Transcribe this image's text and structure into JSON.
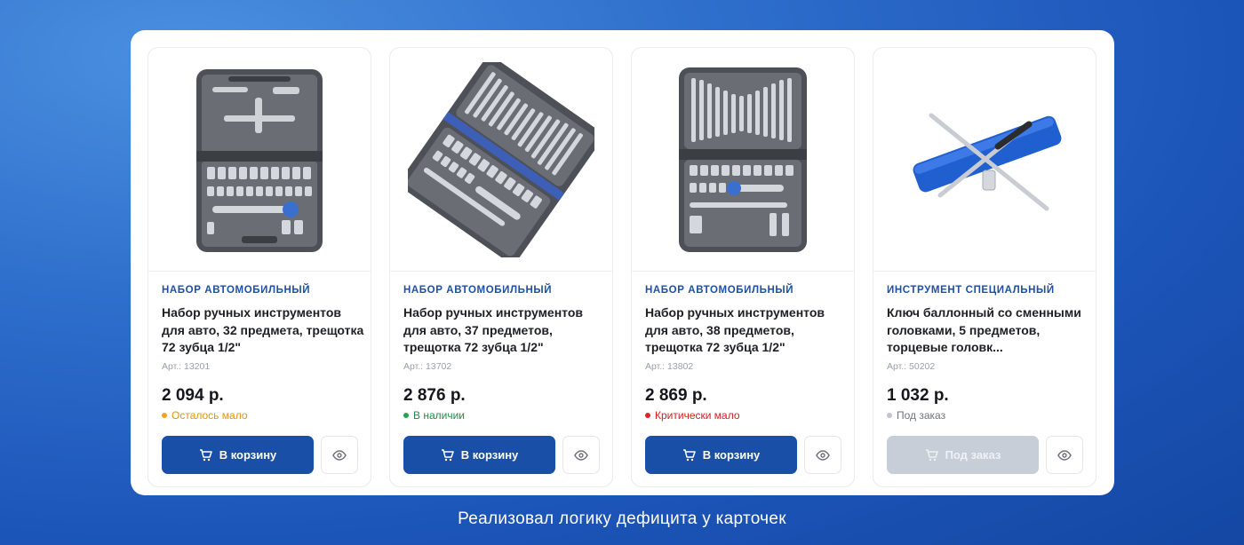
{
  "caption": "Реализовал логику дефицита у карточек",
  "products": [
    {
      "image": "tool-case-socket-set-icon",
      "category": "НАБОР АВТОМОБИЛЬНЫЙ",
      "title": "Набор ручных инструментов для авто, 32 предмета, трещотка 72 зубца 1/2\"",
      "article": "Арт.: 13201",
      "price": "2 094 р.",
      "stock": "Осталось мало",
      "stock_color": "#f0a21a",
      "stock_text_color": "#e09312",
      "button": "В корзину",
      "button_disabled": false
    },
    {
      "image": "tool-case-wrench-set-icon",
      "category": "НАБОР АВТОМОБИЛЬНЫЙ",
      "title": "Набор ручных инструментов для авто, 37 предметов, трещотка 72 зубца 1/2\"",
      "article": "Арт.: 13702",
      "price": "2 876 р.",
      "stock": "В наличии",
      "stock_color": "#26a353",
      "stock_text_color": "#1f8d47",
      "button": "В корзину",
      "button_disabled": false
    },
    {
      "image": "tool-case-wrench-set-icon",
      "category": "НАБОР АВТОМОБИЛЬНЫЙ",
      "title": "Набор ручных инструментов для авто, 38 предметов, трещотка 72 зубца 1/2\"",
      "article": "Арт.: 13802",
      "price": "2 869 р.",
      "stock": "Критически мало",
      "stock_color": "#e02424",
      "stock_text_color": "#d11f1f",
      "button": "В корзину",
      "button_disabled": false
    },
    {
      "image": "cross-lug-wrench-icon",
      "category": "ИНСТРУМЕНТ СПЕЦИАЛЬНЫЙ",
      "title": "Ключ баллонный со сменными головками, 5 предметов, торцевые головк...",
      "article": "Арт.: 50202",
      "price": "1 032 р.",
      "stock": "Под заказ",
      "stock_color": "#c2c6cc",
      "stock_text_color": "#6f747c",
      "button": "Под заказ",
      "button_disabled": true
    }
  ]
}
